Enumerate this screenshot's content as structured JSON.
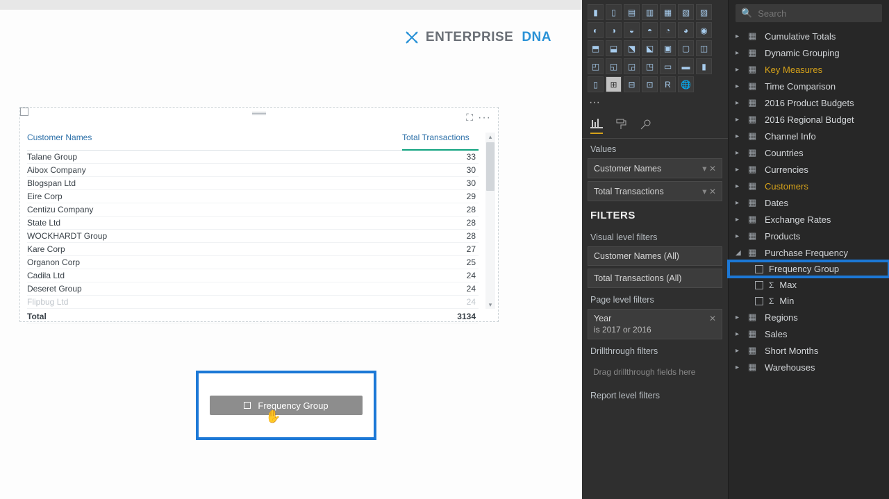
{
  "logo": {
    "word1": "ENTERPRISE",
    "word2": "DNA"
  },
  "table": {
    "columns": [
      "Customer Names",
      "Total Transactions"
    ],
    "rows": [
      {
        "name": "Talane Group",
        "value": 33
      },
      {
        "name": "Aibox Company",
        "value": 30
      },
      {
        "name": "Blogspan Ltd",
        "value": 30
      },
      {
        "name": "Eire Corp",
        "value": 29
      },
      {
        "name": "Centizu Company",
        "value": 28
      },
      {
        "name": "State Ltd",
        "value": 28
      },
      {
        "name": "WOCKHARDT Group",
        "value": 28
      },
      {
        "name": "Kare Corp",
        "value": 27
      },
      {
        "name": "Organon Corp",
        "value": 25
      },
      {
        "name": "Cadila Ltd",
        "value": 24
      },
      {
        "name": "Deseret Group",
        "value": 24
      },
      {
        "name": "Flipbug Ltd",
        "value": 24
      }
    ],
    "total_label": "Total",
    "total_value": 3134
  },
  "drag_widget": {
    "label": "Frequency Group"
  },
  "viz": {
    "values_label": "Values",
    "wells": [
      "Customer Names",
      "Total Transactions"
    ],
    "filters_header": "FILTERS",
    "visual_filters_label": "Visual level filters",
    "visual_filters": [
      "Customer Names  (All)",
      "Total Transactions  (All)"
    ],
    "page_filters_label": "Page level filters",
    "page_filter_field": "Year",
    "page_filter_desc": "is 2017 or 2016",
    "drill_label": "Drillthrough filters",
    "drill_hint": "Drag drillthrough fields here",
    "report_filters_label": "Report level filters"
  },
  "search_placeholder": "Search",
  "fields": {
    "tables": [
      {
        "label": "Cumulative Totals"
      },
      {
        "label": "Dynamic Grouping"
      },
      {
        "label": "Key Measures",
        "tinted": true
      },
      {
        "label": "Time Comparison"
      },
      {
        "label": "2016 Product Budgets"
      },
      {
        "label": "2016 Regional Budget"
      },
      {
        "label": "Channel Info"
      },
      {
        "label": "Countries"
      },
      {
        "label": "Currencies"
      },
      {
        "label": "Customers",
        "tinted": true
      },
      {
        "label": "Dates"
      },
      {
        "label": "Exchange Rates"
      },
      {
        "label": "Products"
      },
      {
        "label": "Purchase Frequency",
        "expanded": true,
        "children": [
          {
            "label": "Frequency Group",
            "highlight": true
          },
          {
            "label": "Max",
            "sigma": true
          },
          {
            "label": "Min",
            "sigma": true
          }
        ]
      },
      {
        "label": "Regions"
      },
      {
        "label": "Sales"
      },
      {
        "label": "Short Months"
      },
      {
        "label": "Warehouses"
      }
    ]
  },
  "chart_data": {
    "type": "table",
    "title": "Total Transactions by Customer",
    "columns": [
      "Customer Names",
      "Total Transactions"
    ],
    "rows": [
      [
        "Talane Group",
        33
      ],
      [
        "Aibox Company",
        30
      ],
      [
        "Blogspan Ltd",
        30
      ],
      [
        "Eire Corp",
        29
      ],
      [
        "Centizu Company",
        28
      ],
      [
        "State Ltd",
        28
      ],
      [
        "WOCKHARDT Group",
        28
      ],
      [
        "Kare Corp",
        27
      ],
      [
        "Organon Corp",
        25
      ],
      [
        "Cadila Ltd",
        24
      ],
      [
        "Deseret Group",
        24
      ],
      [
        "Flipbug Ltd",
        24
      ]
    ],
    "total": 3134
  }
}
